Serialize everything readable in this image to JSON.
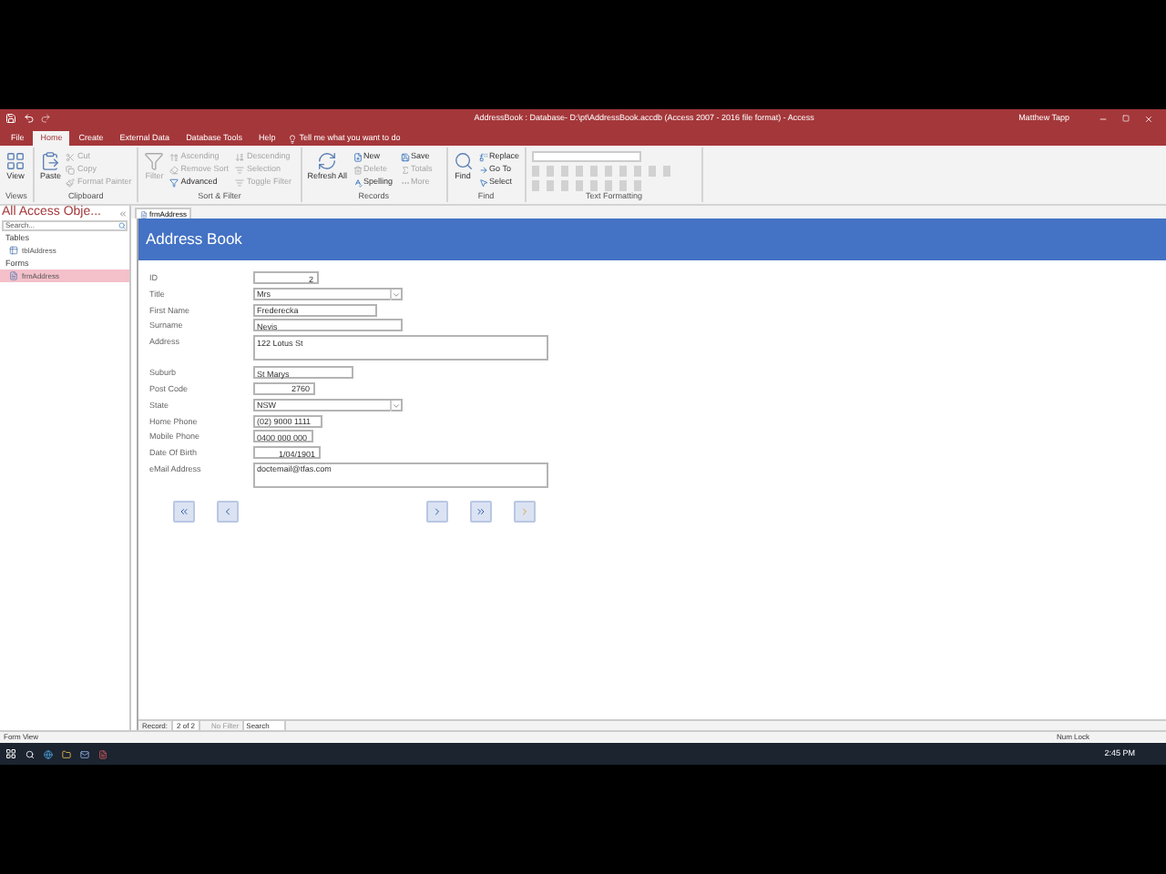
{
  "window": {
    "title": "AddressBook : Database- D:\\pt\\AddressBook.accdb (Access 2007 - 2016 file format) - Access",
    "user": "Matthew Tapp"
  },
  "ribbon_tabs": [
    {
      "label": "File",
      "selected": false
    },
    {
      "label": "Home",
      "selected": true
    },
    {
      "label": "Create",
      "selected": false
    },
    {
      "label": "External Data",
      "selected": false
    },
    {
      "label": "Database Tools",
      "selected": false
    },
    {
      "label": "Help",
      "selected": false
    }
  ],
  "tell_me": {
    "placeholder": "Tell me what you want to do"
  },
  "ribbon_groups": [
    {
      "name": "Views",
      "large": [
        {
          "label": "View",
          "disabled": false
        }
      ]
    },
    {
      "name": "Clipboard",
      "large": [
        {
          "label": "Paste",
          "disabled": false
        }
      ],
      "small": [
        {
          "label": "Cut",
          "disabled": true
        },
        {
          "label": "Copy",
          "disabled": true
        },
        {
          "label": "Format Painter",
          "disabled": true
        }
      ]
    },
    {
      "name": "Sort & Filter",
      "large": [
        {
          "label": "Filter",
          "disabled": true
        }
      ],
      "small": [
        {
          "label": "Ascending",
          "disabled": true
        },
        {
          "label": "Descending",
          "disabled": true
        },
        {
          "label": "Remove Sort",
          "disabled": true
        },
        {
          "label": "Selection",
          "disabled": true
        },
        {
          "label": "Advanced",
          "disabled": false
        },
        {
          "label": "Toggle Filter",
          "disabled": true
        }
      ]
    },
    {
      "name": "Records",
      "large": [
        {
          "label": "Refresh All",
          "disabled": false
        }
      ],
      "small": [
        {
          "label": "New",
          "disabled": false
        },
        {
          "label": "Save",
          "disabled": false
        },
        {
          "label": "Delete",
          "disabled": true
        },
        {
          "label": "Totals",
          "disabled": true
        },
        {
          "label": "Spelling",
          "disabled": false
        },
        {
          "label": "More",
          "disabled": true
        }
      ]
    },
    {
      "name": "Find",
      "large": [
        {
          "label": "Find",
          "disabled": false
        }
      ],
      "small": [
        {
          "label": "Replace",
          "disabled": false
        },
        {
          "label": "Go To",
          "disabled": false
        },
        {
          "label": "Select",
          "disabled": false
        }
      ]
    },
    {
      "name": "Text Formatting"
    }
  ],
  "nav_pane": {
    "title": "All Access Obje...",
    "search": {
      "placeholder": "Search..."
    },
    "groups": [
      {
        "label": "Tables",
        "items": [
          {
            "label": "tblAddress",
            "selected": false
          }
        ]
      },
      {
        "label": "Forms",
        "items": [
          {
            "label": "frmAddress",
            "selected": true
          }
        ]
      }
    ]
  },
  "document_tab": "frmAddress",
  "form": {
    "header": "Address Book",
    "fields": [
      {
        "label": "ID",
        "value": "2",
        "kind": "number"
      },
      {
        "label": "Title",
        "value": "Mrs",
        "kind": "combo"
      },
      {
        "label": "First Name",
        "value": "Frederecka",
        "kind": "text"
      },
      {
        "label": "Surname",
        "value": "Nevis",
        "kind": "text"
      },
      {
        "label": "Address",
        "value": "122 Lotus St",
        "kind": "memo"
      },
      {
        "label": "Suburb",
        "value": "St Marys",
        "kind": "text"
      },
      {
        "label": "Post Code",
        "value": "2760",
        "kind": "number"
      },
      {
        "label": "State",
        "value": "NSW",
        "kind": "combo"
      },
      {
        "label": "Home Phone",
        "value": "(02) 9000 1111",
        "kind": "text"
      },
      {
        "label": "Mobile Phone",
        "value": "0400 000 000",
        "kind": "text"
      },
      {
        "label": "Date Of Birth",
        "value": "1/04/1901",
        "kind": "number"
      },
      {
        "label": "eMail Address",
        "value": "doctemail@tfas.com",
        "kind": "memo"
      }
    ],
    "nav_buttons": [
      {
        "kind": "first"
      },
      {
        "kind": "previous"
      },
      {
        "kind": "next"
      },
      {
        "kind": "last"
      },
      {
        "kind": "new"
      }
    ]
  },
  "record_bar": {
    "label": "Record:",
    "position": "2 of 2",
    "filter": "No Filter",
    "search": {
      "placeholder": "Search"
    }
  },
  "status_bar": {
    "view": "Form View",
    "num_lock": "Num Lock"
  },
  "taskbar": {
    "time": "2:45 PM"
  }
}
